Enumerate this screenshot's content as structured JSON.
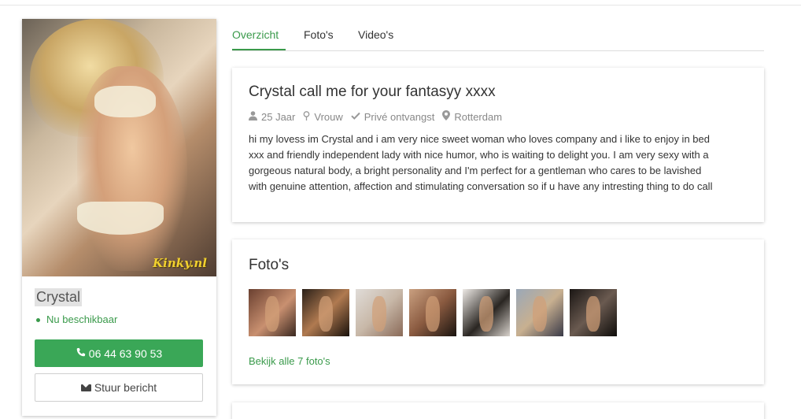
{
  "profile": {
    "name": "Crystal",
    "status": "Nu beschikbaar",
    "phone": "06 44 63 90 53",
    "message_label": "Stuur bericht",
    "watermark": "Kinky.nl"
  },
  "tabs": [
    {
      "label": "Overzicht"
    },
    {
      "label": "Foto's"
    },
    {
      "label": "Video's"
    }
  ],
  "overview": {
    "title": "Crystal call me for your fantasyy xxxx",
    "age": "25 Jaar",
    "gender": "Vrouw",
    "reception": "Privé ontvangst",
    "city": "Rotterdam",
    "description_lines": [
      "hi my lovess im Crystal and i am very nice sweet woman who loves company and i like to enjoy in bed",
      "xxx and friendly independent lady with nice humor, who is waiting to delight you. I am very sexy with a",
      "gorgeous natural body, a bright personality and I'm perfect for a gentleman who cares to be lavished",
      "with genuine attention, affection and stimulating conversation so if u have any intresting thing to do call"
    ]
  },
  "photos": {
    "title": "Foto's",
    "link": "Bekijk alle 7 foto's"
  },
  "colors": {
    "accent": "#3a9a4b",
    "button_green": "#3aa757"
  }
}
